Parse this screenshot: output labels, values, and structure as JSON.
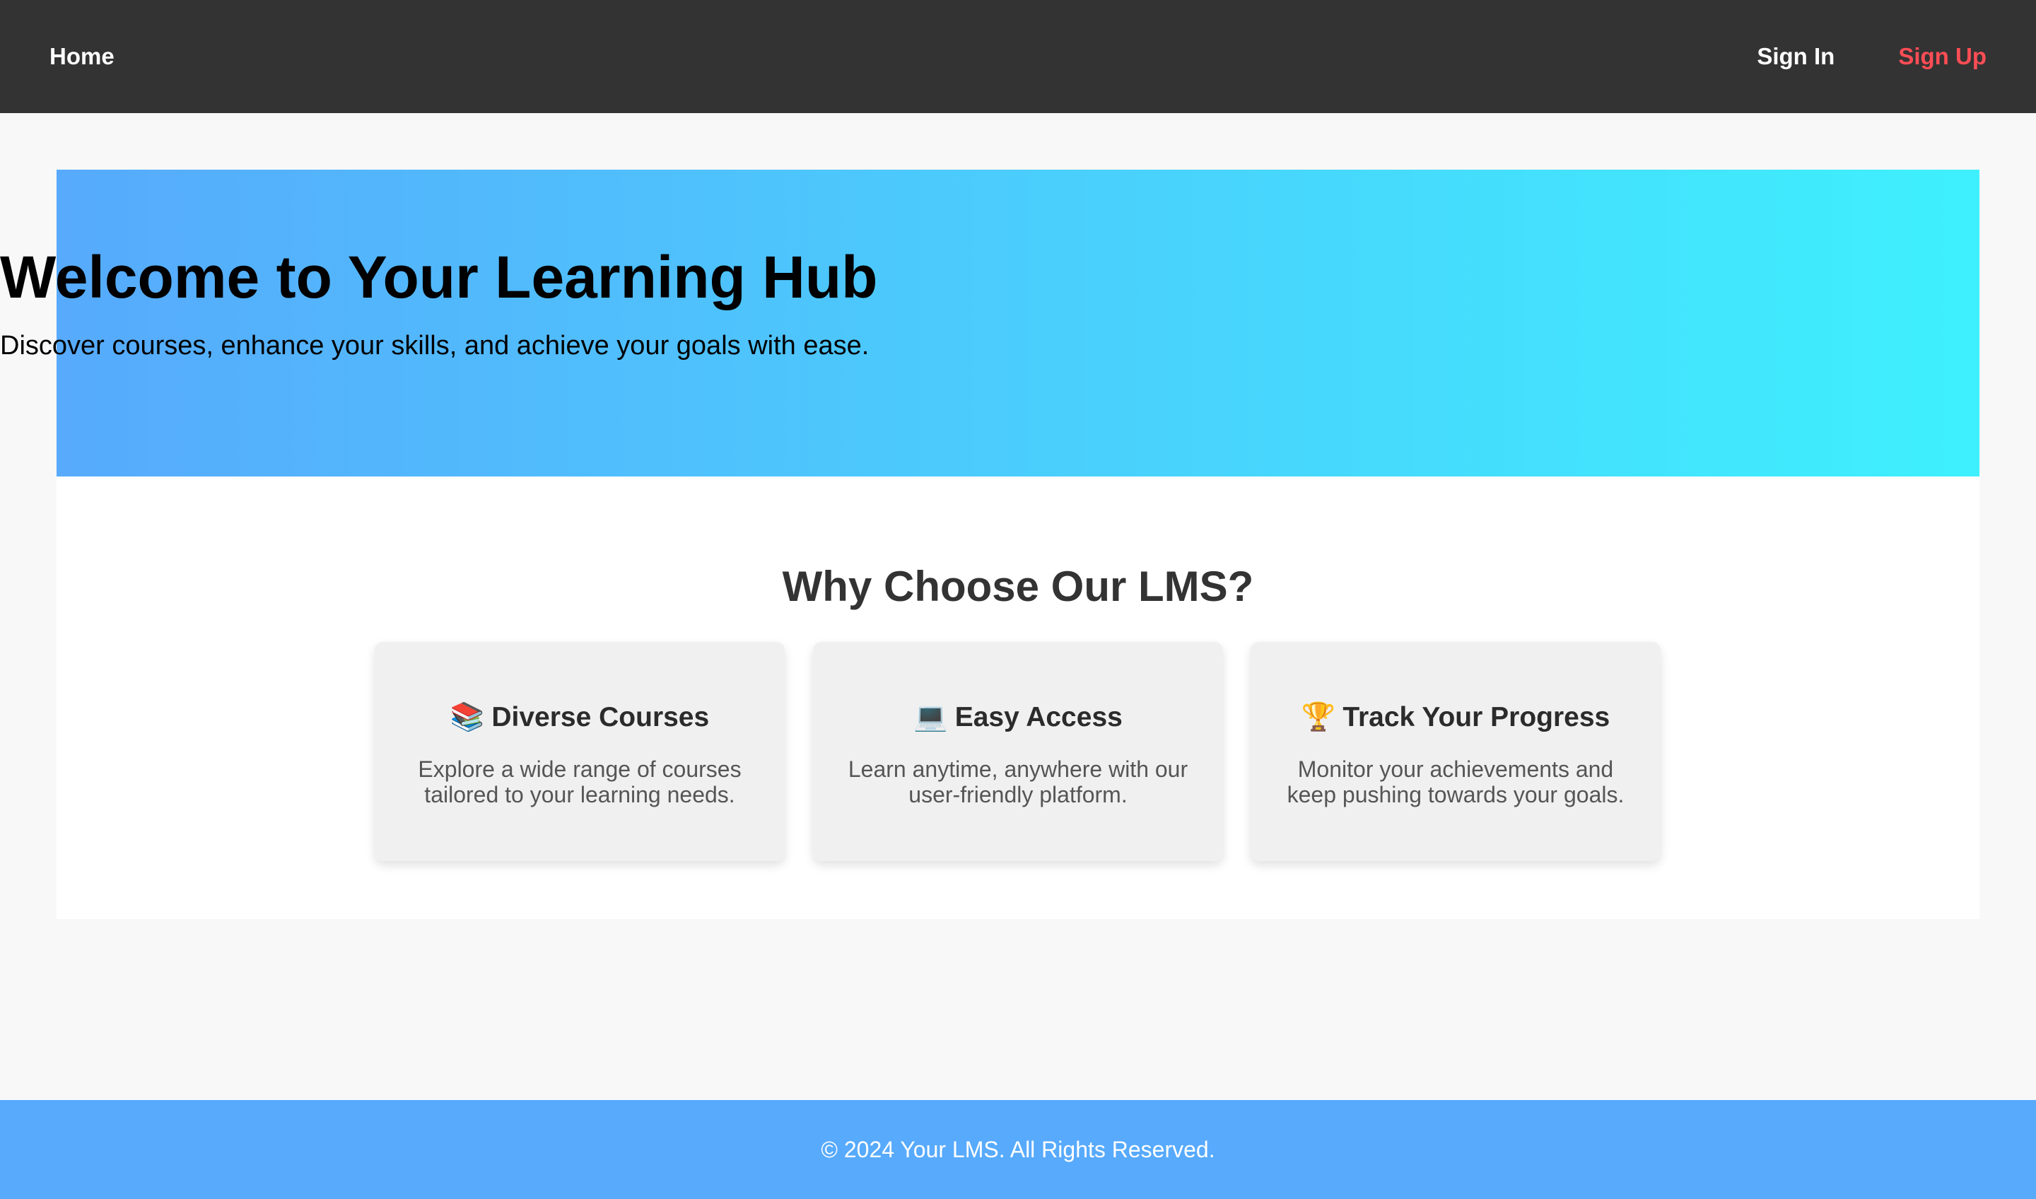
{
  "nav": {
    "home": "Home",
    "sign_in": "Sign In",
    "sign_up": "Sign Up"
  },
  "hero": {
    "title": "Welcome to Your Learning Hub",
    "subtitle": "Discover courses, enhance your skills, and achieve your goals with ease."
  },
  "features": {
    "title": "Why Choose Our LMS?",
    "cards": [
      {
        "icon": "📚",
        "icon_name": "books-icon",
        "title": "Diverse Courses",
        "text": "Explore a wide range of courses tailored to your learning needs."
      },
      {
        "icon": "💻",
        "icon_name": "laptop-icon",
        "title": "Easy Access",
        "text": "Learn anytime, anywhere with our user-friendly platform."
      },
      {
        "icon": "🏆",
        "icon_name": "trophy-icon",
        "title": "Track Your Progress",
        "text": "Monitor your achievements and keep pushing towards your goals."
      }
    ]
  },
  "footer": {
    "text": "© 2024 Your LMS. All Rights Reserved."
  },
  "colors": {
    "navbar_bg": "#333333",
    "sign_up_accent": "#ff4d55",
    "hero_gradient_start": "#57aafc",
    "hero_gradient_end": "#3ef0fd",
    "footer_bg": "#57aafc",
    "card_bg": "#f0f0f0"
  }
}
